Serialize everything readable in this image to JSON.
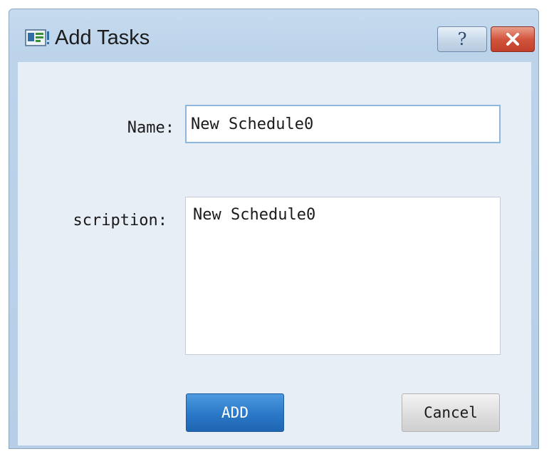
{
  "window": {
    "title": "Add Tasks",
    "title_icon": "app-window-icon",
    "help_button": {
      "label": "?",
      "icon": "help-icon"
    },
    "close_button": {
      "icon": "close-icon"
    }
  },
  "form": {
    "name_label": "Name:",
    "name_value": "New Schedule0",
    "description_label": "scription:",
    "description_value": "New Schedule0"
  },
  "buttons": {
    "add_label": "ADD",
    "cancel_label": "Cancel"
  },
  "colors": {
    "add_button": "#2a78c7",
    "close_button": "#d3553d",
    "client_background": "#e8eef6"
  }
}
